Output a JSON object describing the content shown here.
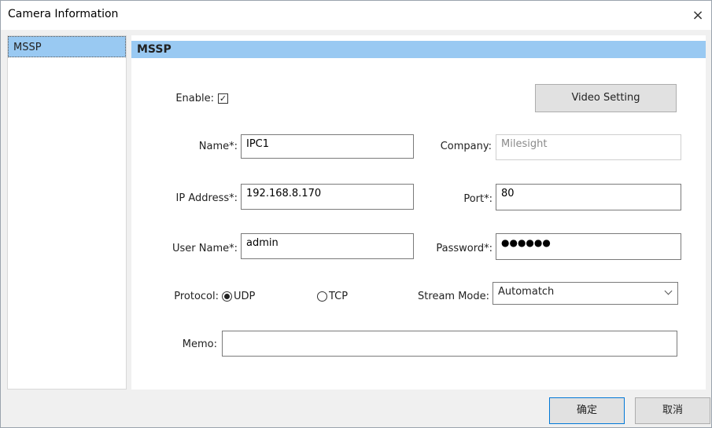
{
  "window": {
    "title": "Camera Information",
    "close_glyph": "×"
  },
  "sidebar": {
    "items": [
      {
        "label": "MSSP"
      }
    ]
  },
  "panel": {
    "title": "MSSP"
  },
  "form": {
    "enable": {
      "label": "Enable:",
      "checked": true,
      "check_glyph": "✓"
    },
    "video_setting_label": "Video Setting",
    "name": {
      "label": "Name*:",
      "value": "IPC1"
    },
    "company": {
      "label": "Company:",
      "value": "Milesight"
    },
    "ip_address": {
      "label": "IP Address*:",
      "value": "192.168.8.170"
    },
    "port": {
      "label": "Port*:",
      "value": "80"
    },
    "user_name": {
      "label": "User Name*:",
      "value": "admin"
    },
    "password": {
      "label": "Password*:",
      "value": "●●●●●●"
    },
    "protocol": {
      "label": "Protocol:",
      "options": [
        "UDP",
        "TCP"
      ],
      "selected": "UDP"
    },
    "stream_mode": {
      "label": "Stream Mode:",
      "value": "Automatch"
    },
    "memo": {
      "label": "Memo:",
      "value": ""
    }
  },
  "footer": {
    "ok_label": "确定",
    "cancel_label": "取消"
  }
}
